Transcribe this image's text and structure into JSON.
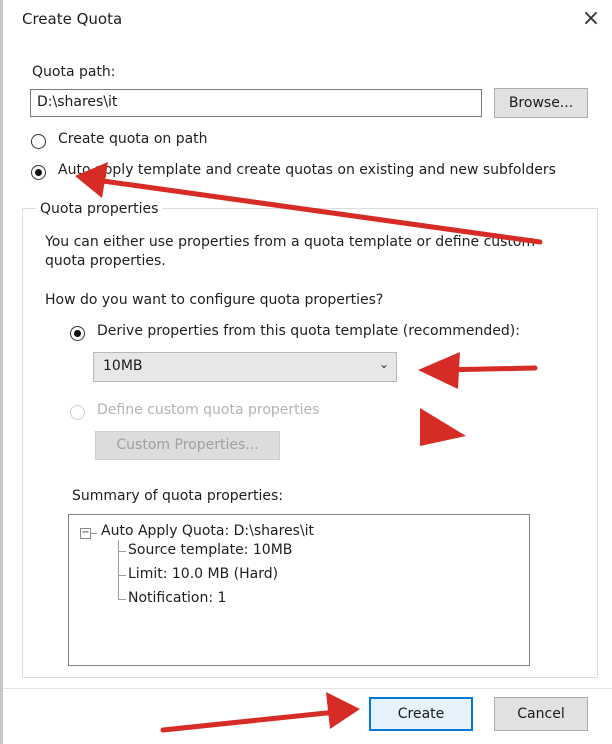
{
  "dialog": {
    "title": "Create Quota",
    "close_glyph": "×"
  },
  "quota_path": {
    "label": "Quota path:",
    "value": "D:\\shares\\it",
    "browse_label": "Browse..."
  },
  "mode": {
    "option_create_on_path": "Create quota on path",
    "option_auto_apply": "Auto apply template and create quotas on existing and new subfolders",
    "selected": "auto_apply"
  },
  "properties": {
    "group_label": "Quota properties",
    "description_line1": "You can either use properties from a quota template or define custom",
    "description_line2": "quota properties.",
    "question": "How do you want to configure quota properties?",
    "option_derive": "Derive properties from this quota template (recommended):",
    "template_selected": "10MB",
    "option_custom": "Define custom quota properties",
    "custom_button_label": "Custom Properties...",
    "selected": "derive"
  },
  "summary": {
    "label": "Summary of quota properties:",
    "root": "Auto Apply Quota: D:\\shares\\it",
    "children": [
      "Source template: 10MB",
      "Limit: 10.0 MB (Hard)",
      "Notification: 1"
    ]
  },
  "footer": {
    "create_label": "Create",
    "cancel_label": "Cancel"
  },
  "annotation_color": "#d62c25"
}
